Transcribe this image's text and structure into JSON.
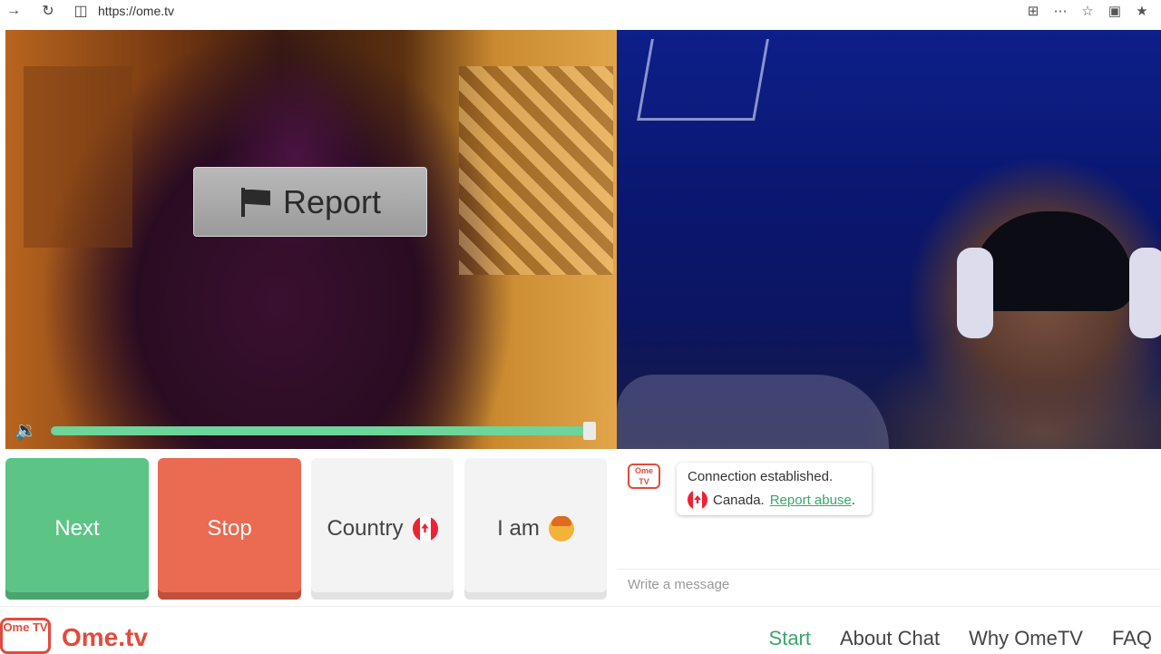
{
  "browser": {
    "url": "https://ome.tv",
    "icons": [
      "forward-icon",
      "reload-icon",
      "site-info-icon",
      "apps-icon",
      "more-icon",
      "favorite-star-icon",
      "video-icon",
      "favorites-icon"
    ]
  },
  "video_left": {
    "report_label": "Report",
    "volume_level": 0.99
  },
  "controls": {
    "next_label": "Next",
    "stop_label": "Stop",
    "country_label": "Country",
    "iam_label": "I am"
  },
  "chat": {
    "logo_text": "Ome TV",
    "status_text": "Connection established.",
    "country_text": "Canada.",
    "report_link": "Report abuse",
    "period": ".",
    "input_placeholder": "Write a message"
  },
  "footer": {
    "logo_text": "Ome TV",
    "brand": "Ome.tv",
    "nav": [
      {
        "label": "Start",
        "active": true
      },
      {
        "label": "About Chat",
        "active": false
      },
      {
        "label": "Why OmeTV",
        "active": false
      },
      {
        "label": "FAQ",
        "active": false
      }
    ]
  },
  "colors": {
    "accent_green": "#5cc585",
    "stop_red": "#ea6a52",
    "brand_red": "#e24a3c",
    "link_green": "#3aa56a"
  }
}
